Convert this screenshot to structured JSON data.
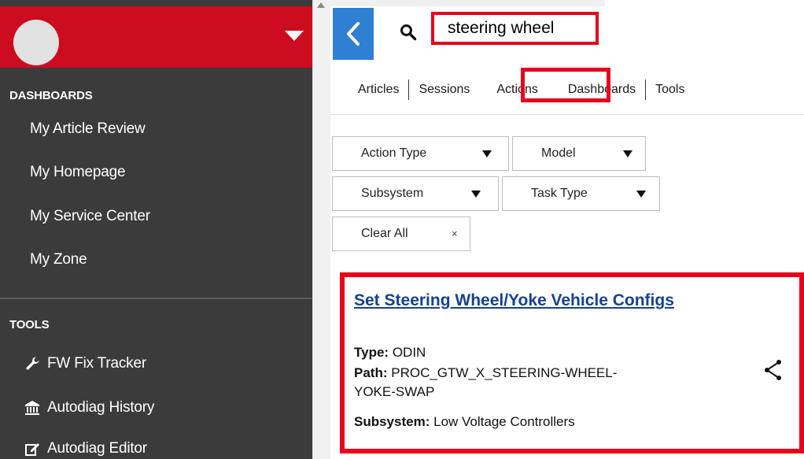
{
  "search": {
    "query": "steering wheel"
  },
  "sidebar": {
    "sections": [
      {
        "title": "DASHBOARDS",
        "items": [
          {
            "label": "My Article Review"
          },
          {
            "label": "My Homepage"
          },
          {
            "label": "My Service Center"
          },
          {
            "label": "My Zone"
          }
        ]
      },
      {
        "title": "TOOLS",
        "items": [
          {
            "label": "FW Fix Tracker",
            "icon": "wrench-icon"
          },
          {
            "label": "Autodiag History",
            "icon": "bank-icon"
          },
          {
            "label": "Autodiag Editor",
            "icon": "edit-icon"
          }
        ]
      }
    ]
  },
  "tabs": [
    {
      "label": "Articles"
    },
    {
      "label": "Sessions"
    },
    {
      "label": "Actions",
      "active": true
    },
    {
      "label": "Dashboards"
    },
    {
      "label": "Tools"
    }
  ],
  "filters": {
    "action_type": "Action Type",
    "model": "Model",
    "subsystem": "Subsystem",
    "task_type": "Task Type",
    "clear_all": "Clear All",
    "clear_x": "×"
  },
  "result": {
    "title": "Set Steering Wheel/Yoke Vehicle Configs",
    "type_label": "Type:",
    "type_value": "ODIN",
    "path_label": "Path:",
    "path_value_1": "PROC_GTW_X_STEERING-WHEEL-",
    "path_value_2": "YOKE-SWAP",
    "subsystem_label": "Subsystem:",
    "subsystem_value": "Low Voltage Controllers"
  },
  "colors": {
    "sidebar_bg": "#3b3b3b",
    "header_red": "#cc0c1f",
    "back_button_blue": "#2f7fd3",
    "highlight_red": "#e8001c",
    "link_blue": "#16418f"
  }
}
